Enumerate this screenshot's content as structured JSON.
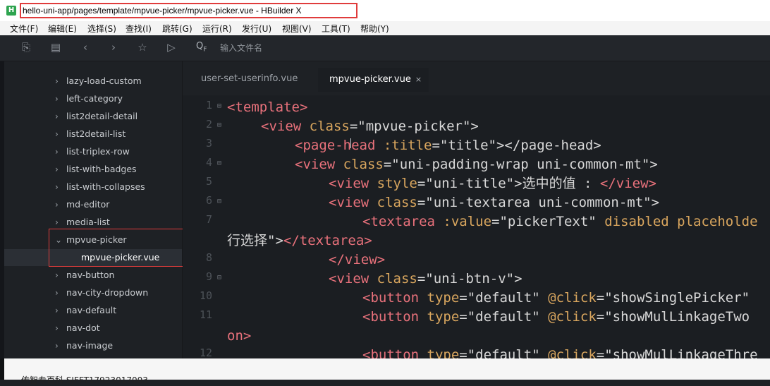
{
  "window": {
    "title": "hello-uni-app/pages/template/mpvue-picker/mpvue-picker.vue - HBuilder X",
    "app_icon": "H"
  },
  "menu": [
    "文件(F)",
    "编辑(E)",
    "选择(S)",
    "查找(I)",
    "跳转(G)",
    "运行(R)",
    "发行(U)",
    "视图(V)",
    "工具(T)",
    "帮助(Y)"
  ],
  "toolbar": {
    "icons": [
      "new-file-icon",
      "save-icon",
      "back-icon",
      "forward-icon",
      "star-icon",
      "run-icon"
    ],
    "search_icon_glyph": "Q",
    "search_icon_sub": "F",
    "search_placeholder": "输入文件名"
  },
  "sidebar": {
    "items": [
      {
        "label": "lazy-load-custom",
        "expanded": false
      },
      {
        "label": "left-category",
        "expanded": false
      },
      {
        "label": "list2detail-detail",
        "expanded": false
      },
      {
        "label": "list2detail-list",
        "expanded": false
      },
      {
        "label": "list-triplex-row",
        "expanded": false
      },
      {
        "label": "list-with-badges",
        "expanded": false
      },
      {
        "label": "list-with-collapses",
        "expanded": false
      },
      {
        "label": "md-editor",
        "expanded": false
      },
      {
        "label": "media-list",
        "expanded": false
      },
      {
        "label": "mpvue-picker",
        "expanded": true
      },
      {
        "label": "mpvue-picker.vue",
        "child": true
      },
      {
        "label": "nav-button",
        "expanded": false
      },
      {
        "label": "nav-city-dropdown",
        "expanded": false
      },
      {
        "label": "nav-default",
        "expanded": false
      },
      {
        "label": "nav-dot",
        "expanded": false
      },
      {
        "label": "nav-image",
        "expanded": false
      }
    ]
  },
  "tabs": [
    {
      "label": "user-set-userinfo.vue",
      "active": false
    },
    {
      "label": "mpvue-picker.vue",
      "active": true,
      "close": "×"
    }
  ],
  "editor": {
    "line_numbers": [
      "1",
      "2",
      "3",
      "4",
      "5",
      "6",
      "7",
      "8",
      "9",
      "10",
      "11",
      "12"
    ],
    "code": {
      "l1_tag": "<template>",
      "l2_a": "<view ",
      "l2_b": "class",
      "l2_c": "=\"mpvue-picker\">",
      "l3_a": "<page-head ",
      "l3_b": ":title",
      "l3_c": "=\"title\"></page-head>",
      "l4_a": "<view ",
      "l4_b": "class",
      "l4_c": "=\"uni-padding-wrap uni-common-mt\">",
      "l5_a": "<view ",
      "l5_b": "style",
      "l5_c": "=\"uni-title\">",
      "l5_d": "选中的值 : ",
      "l5_e": "</view>",
      "l6_a": "<view ",
      "l6_b": "class",
      "l6_c": "=\"uni-textarea uni-common-mt\">",
      "l7_a": "<textarea ",
      "l7_b": ":value",
      "l7_c": "=\"pickerText\" ",
      "l7_d": "disabled placeholde",
      "l7w_a": "行选择\">",
      "l7w_b": "</textarea>",
      "l8_a": "</view>",
      "l9_a": "<view ",
      "l9_b": "class",
      "l9_c": "=\"uni-btn-v\">",
      "l10_a": "<button ",
      "l10_b": "type",
      "l10_c": "=\"default\" ",
      "l10_d": "@click",
      "l10_e": "=\"showSinglePicker\"",
      "l11_a": "<button ",
      "l11_b": "type",
      "l11_c": "=\"default\" ",
      "l11_d": "@click",
      "l11_e": "=\"showMulLinkageTwo",
      "l11w_a": "on>",
      "l12_a": "<button ",
      "l12_b": "type",
      "l12_c": "=\"default\" ",
      "l12_d": "@click",
      "l12_e": "=\"showMulLinkageThre"
    }
  },
  "status": {
    "text": "传智专百科  SJFFT17923017003"
  },
  "colors": {
    "tag": "#e8717b",
    "attribute": "#d9a65e",
    "highlight_border": "#e03c3c"
  }
}
